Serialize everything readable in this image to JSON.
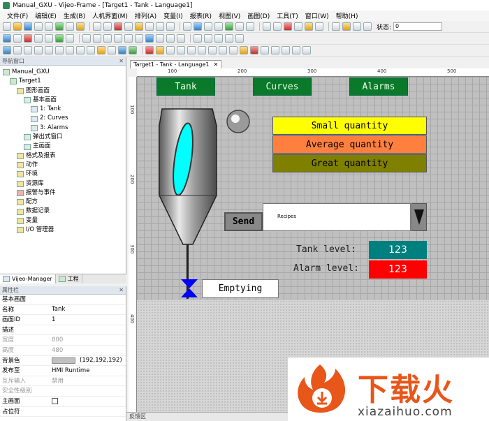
{
  "window": {
    "title": "Manual_GXU - Vijeo-Frame - [Target1 - Tank - Language1]"
  },
  "menu": [
    "文件(F)",
    "编辑(E)",
    "生成(B)",
    "人机界面(M)",
    "排列(A)",
    "变量(I)",
    "报表(R)",
    "视图(V)",
    "画图(D)",
    "工具(T)",
    "窗口(W)",
    "帮助(H)"
  ],
  "toolbar": {
    "state_label": "状态:",
    "state_value": "0"
  },
  "nav": {
    "title": "导航窗口",
    "tree": [
      {
        "label": "Manual_GXU",
        "indent": 0,
        "icon": "project-icon"
      },
      {
        "label": "Target1",
        "indent": 1,
        "icon": "target-icon"
      },
      {
        "label": "图形画面",
        "indent": 2,
        "icon": "panels-icon"
      },
      {
        "label": "基本画面",
        "indent": 3,
        "icon": "panels-icon"
      },
      {
        "label": "1: Tank",
        "indent": 4,
        "icon": "panel-icon"
      },
      {
        "label": "2: Curves",
        "indent": 4,
        "icon": "panel-icon"
      },
      {
        "label": "3: Alarms",
        "indent": 4,
        "icon": "panel-icon"
      },
      {
        "label": "弹出式窗口",
        "indent": 3,
        "icon": "popup-icon"
      },
      {
        "label": "主画面",
        "indent": 3,
        "icon": "master-panel-icon"
      },
      {
        "label": "格式及报表",
        "indent": 2,
        "icon": "report-icon"
      },
      {
        "label": "动作",
        "indent": 2,
        "icon": "action-icon"
      },
      {
        "label": "环境",
        "indent": 2,
        "icon": "environment-icon"
      },
      {
        "label": "资源库",
        "indent": 2,
        "icon": "resources-icon"
      },
      {
        "label": "报警与事件",
        "indent": 2,
        "icon": "alarm-icon"
      },
      {
        "label": "配方",
        "indent": 2,
        "icon": "recipe-icon"
      },
      {
        "label": "数据记录",
        "indent": 2,
        "icon": "datalog-icon"
      },
      {
        "label": "变量",
        "indent": 2,
        "icon": "variable-icon"
      },
      {
        "label": "I/O 管理器",
        "indent": 2,
        "icon": "io-manager-icon"
      }
    ],
    "tabs": [
      "Vijeo-Manager",
      "工程"
    ]
  },
  "props": {
    "title": "属性栏",
    "section": "基本画面",
    "rows": [
      {
        "k": "名称",
        "v": "Tank",
        "dim": false
      },
      {
        "k": "画面ID",
        "v": "1",
        "dim": false
      },
      {
        "k": "描述",
        "v": "",
        "dim": false
      },
      {
        "k": "宽度",
        "v": "800",
        "dim": true
      },
      {
        "k": "高度",
        "v": "480",
        "dim": true
      },
      {
        "k": "背景色",
        "v": "(192,192,192)",
        "dim": false,
        "swatch": "#c0c0c0"
      },
      {
        "k": "发布至",
        "v": "HMI Runtime",
        "dim": false
      },
      {
        "k": "互斥输入",
        "v": "禁用",
        "dim": true
      },
      {
        "k": "安全性级别",
        "v": "",
        "dim": true
      },
      {
        "k": "主画面",
        "v": "",
        "dim": false,
        "checkbox": true
      },
      {
        "k": "占位符",
        "v": "",
        "dim": false
      }
    ]
  },
  "editor": {
    "doc_tab": "Target1 - Tank - Language1",
    "ruler_top": [
      "100",
      "200",
      "300",
      "400",
      "500"
    ],
    "ruler_left": [
      "100",
      "200",
      "300",
      "400"
    ],
    "bottom_label": "反馈区"
  },
  "hmi": {
    "nav_buttons": [
      "Tank",
      "Curves",
      "Alarms"
    ],
    "quantity_boxes": [
      {
        "label": "Small quantity",
        "color": "#ffff00"
      },
      {
        "label": "Average quantity",
        "color": "#ff7f3f"
      },
      {
        "label": "Great quantity",
        "color": "#7f7f00"
      }
    ],
    "send_label": "Send",
    "recipes_label": "Recipes",
    "tank_level_label": "Tank level:",
    "tank_level_value": "123",
    "tank_level_color": "#007f7f",
    "alarm_level_label": "Alarm level:",
    "alarm_level_value": "123",
    "alarm_level_color": "#ff0000",
    "emptying_label": "Emptying"
  },
  "watermark": {
    "brand": "下载火",
    "url": "xiazaihuo.com"
  }
}
